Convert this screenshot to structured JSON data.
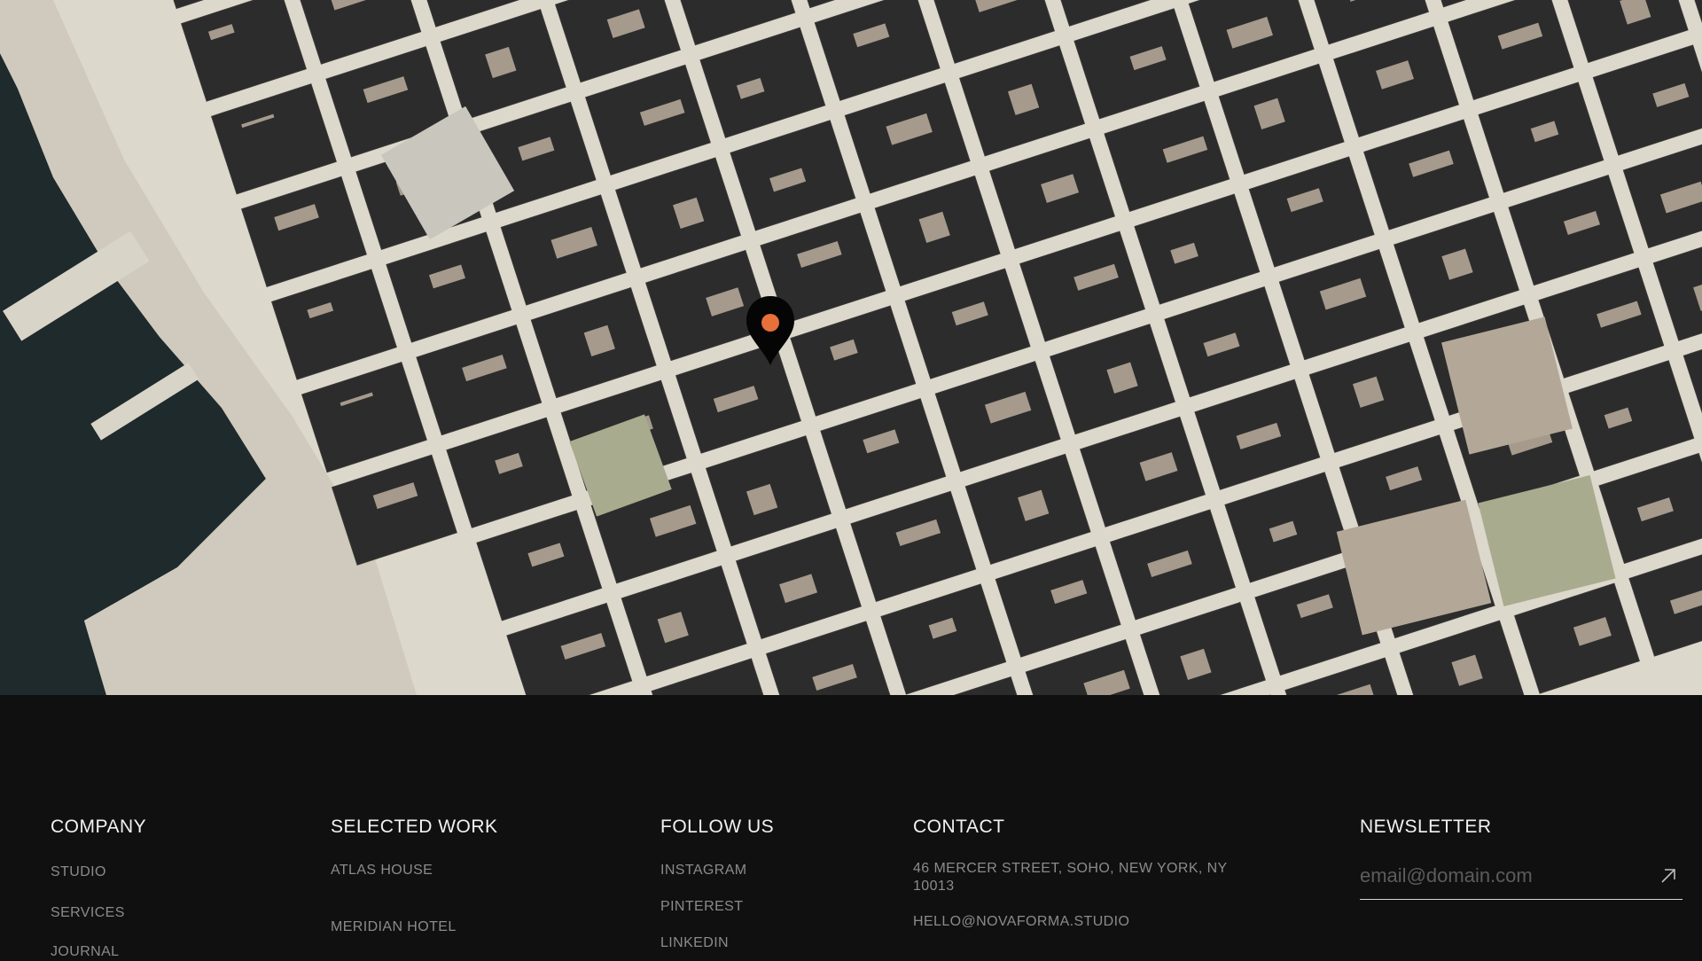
{
  "map": {
    "accent_color": "#e8703a",
    "pin_icon": "location-pin-icon"
  },
  "footer": {
    "company": {
      "heading": "COMPANY",
      "links": [
        "STUDIO",
        "SERVICES",
        "JOURNAL"
      ]
    },
    "work": {
      "heading": "SELECTED WORK",
      "links": [
        "ATLAS HOUSE",
        "MERIDIAN HOTEL"
      ]
    },
    "follow": {
      "heading": "FOLLOW US",
      "links": [
        "INSTAGRAM",
        "PINTEREST",
        "LINKEDIN"
      ]
    },
    "contact": {
      "heading": "CONTACT",
      "address": "46 MERCER STREET, SOHO, NEW YORK, NY 10013",
      "email": "HELLO@NOVAFORMA.STUDIO"
    },
    "newsletter": {
      "heading": "NEWSLETTER",
      "placeholder": "email@domain.com",
      "submit_icon": "arrow-up-right-icon"
    }
  }
}
